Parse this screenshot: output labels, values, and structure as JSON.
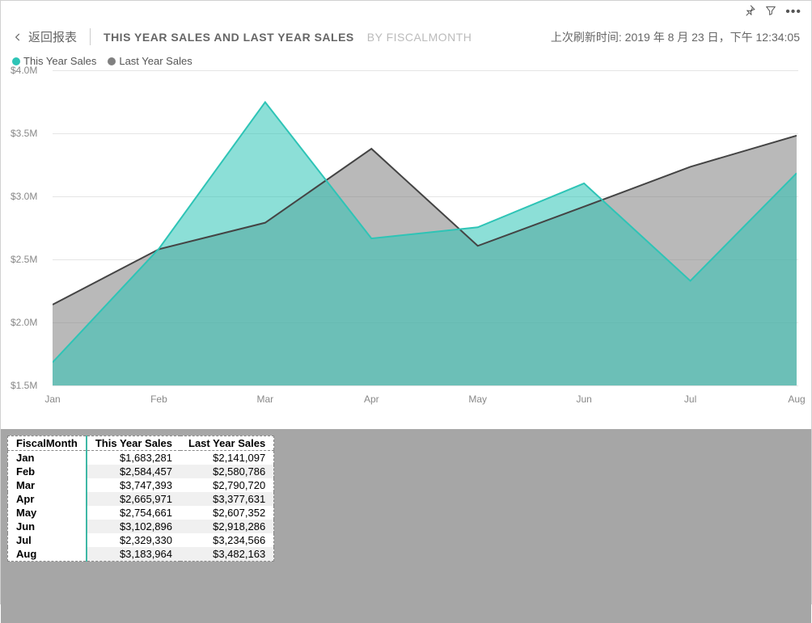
{
  "toolbar": {
    "pin_name": "pin-icon",
    "filter_name": "filter-icon",
    "more_name": "more-icon"
  },
  "header": {
    "back_label": "返回报表",
    "title": "THIS YEAR SALES AND LAST YEAR SALES",
    "subtitle": "BY FISCALMONTH",
    "refresh": "上次刷新时间: 2019 年 8 月 23 日，下午 12:34:05"
  },
  "legend": {
    "s1": "This Year Sales",
    "s2": "Last Year Sales",
    "c1": "#2ec4b6",
    "c2": "#808080"
  },
  "yaxis": [
    "$1.5M",
    "$2.0M",
    "$2.5M",
    "$3.0M",
    "$3.5M",
    "$4.0M"
  ],
  "xaxis": [
    "Jan",
    "Feb",
    "Mar",
    "Apr",
    "May",
    "Jun",
    "Jul",
    "Aug"
  ],
  "table": {
    "h0": "FiscalMonth",
    "h1": "This Year Sales",
    "h2": "Last Year Sales",
    "rows": [
      {
        "m": "Jan",
        "a": "$1,683,281",
        "b": "$2,141,097"
      },
      {
        "m": "Feb",
        "a": "$2,584,457",
        "b": "$2,580,786"
      },
      {
        "m": "Mar",
        "a": "$3,747,393",
        "b": "$2,790,720"
      },
      {
        "m": "Apr",
        "a": "$2,665,971",
        "b": "$3,377,631"
      },
      {
        "m": "May",
        "a": "$2,754,661",
        "b": "$2,607,352"
      },
      {
        "m": "Jun",
        "a": "$3,102,896",
        "b": "$2,918,286"
      },
      {
        "m": "Jul",
        "a": "$2,329,330",
        "b": "$3,234,566"
      },
      {
        "m": "Aug",
        "a": "$3,183,964",
        "b": "$3,482,163"
      }
    ]
  },
  "chart_data": {
    "type": "area",
    "title": "This Year Sales and Last Year Sales",
    "subtitle": "by FiscalMonth",
    "xlabel": "",
    "ylabel": "",
    "ylim": [
      1500000,
      4000000
    ],
    "categories": [
      "Jan",
      "Feb",
      "Mar",
      "Apr",
      "May",
      "Jun",
      "Jul",
      "Aug"
    ],
    "series": [
      {
        "name": "This Year Sales",
        "color": "#2ec4b6",
        "values": [
          1683281,
          2584457,
          3747393,
          2665971,
          2754661,
          3102896,
          2329330,
          3183964
        ]
      },
      {
        "name": "Last Year Sales",
        "color": "#808080",
        "values": [
          2141097,
          2580786,
          2790720,
          3377631,
          2607352,
          2918286,
          3234566,
          3482163
        ]
      }
    ]
  }
}
